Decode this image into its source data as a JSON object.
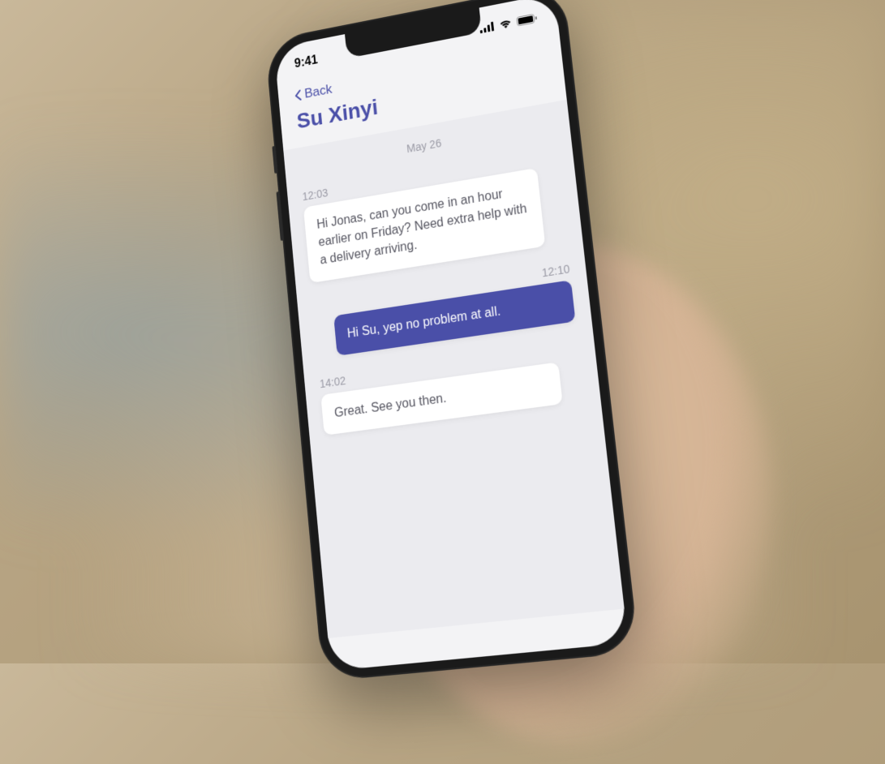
{
  "status": {
    "time": "9:41"
  },
  "header": {
    "back_label": "Back",
    "contact_name": "Su Xinyi"
  },
  "chat": {
    "date": "May 26",
    "messages": [
      {
        "time": "12:03",
        "text": "Hi Jonas, can you come in an hour earlier on Friday? Need extra help with a delivery arriving.",
        "direction": "incoming"
      },
      {
        "time": "12:10",
        "text": "Hi Su, yep no problem at all.",
        "direction": "outgoing"
      },
      {
        "time": "14:02",
        "text": "Great. See you then.",
        "direction": "incoming"
      }
    ]
  },
  "colors": {
    "accent": "#4a4fa8",
    "screen_bg": "#f3f3f5",
    "chat_bg": "#ebebef"
  }
}
